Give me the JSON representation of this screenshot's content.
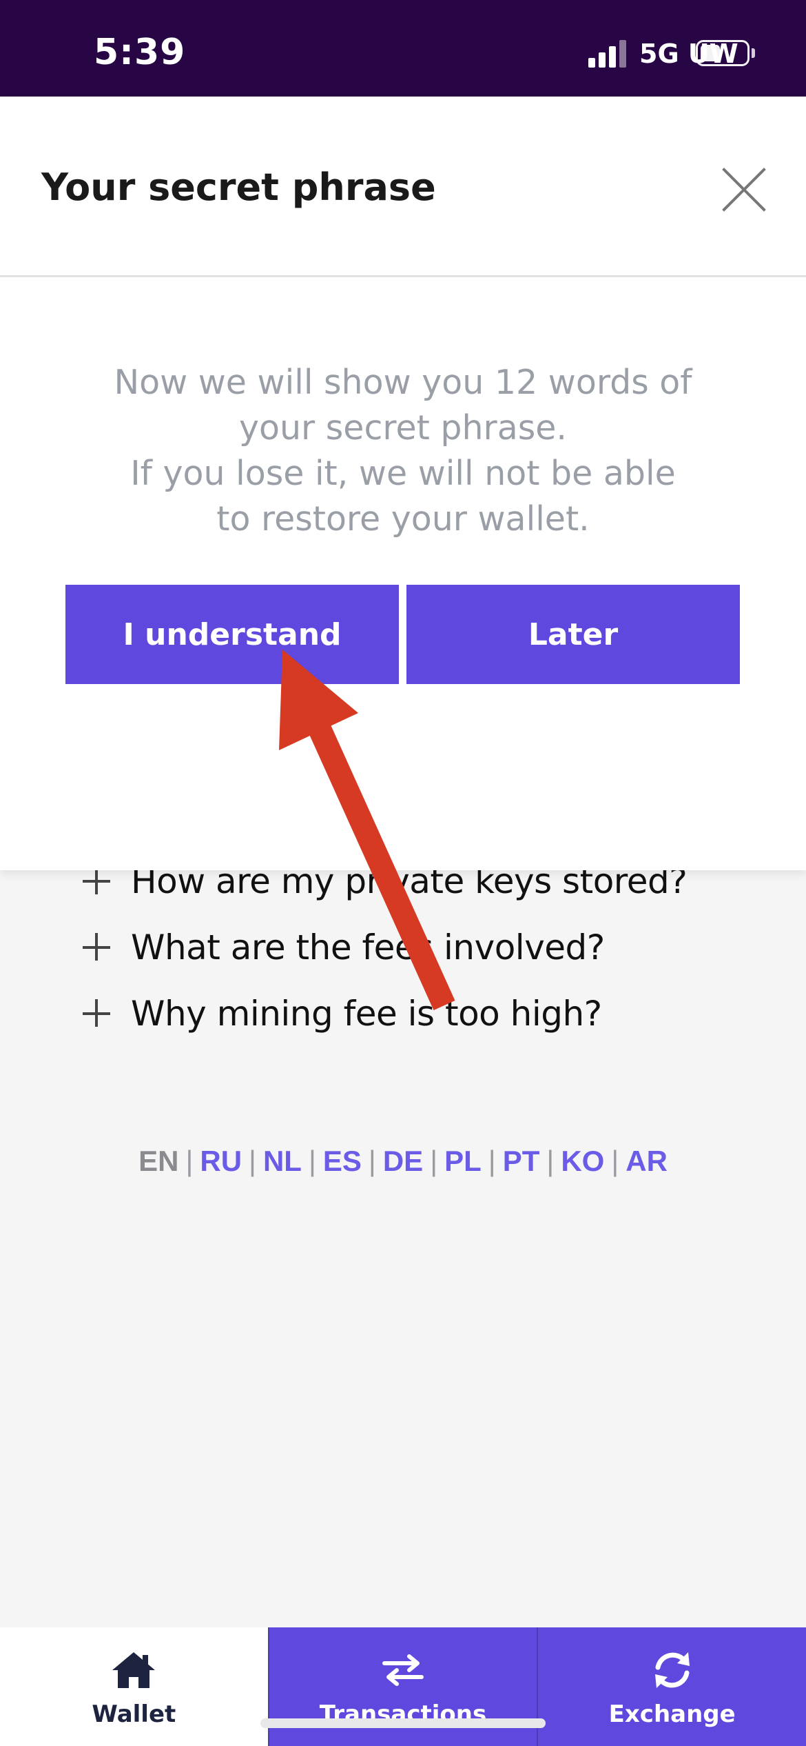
{
  "status_bar": {
    "time": "5:39",
    "network": "5G UW"
  },
  "background": {
    "faq": [
      "How are my private keys stored?",
      "What are the fees involved?",
      "Why mining fee is too high?"
    ],
    "languages": [
      {
        "code": "EN",
        "active": true
      },
      {
        "code": "RU",
        "active": false
      },
      {
        "code": "NL",
        "active": false
      },
      {
        "code": "ES",
        "active": false
      },
      {
        "code": "DE",
        "active": false
      },
      {
        "code": "PL",
        "active": false
      },
      {
        "code": "PT",
        "active": false
      },
      {
        "code": "KO",
        "active": false
      },
      {
        "code": "AR",
        "active": false
      }
    ]
  },
  "modal": {
    "title": "Your secret phrase",
    "message_lines": [
      "Now we will show you 12 words of",
      "your secret phrase.",
      "If you lose it, we will not be able",
      "to restore your wallet."
    ],
    "understand_label": "I understand",
    "later_label": "Later"
  },
  "bottom_nav": [
    {
      "label": "Wallet",
      "icon": "home-icon",
      "active": true
    },
    {
      "label": "Transactions",
      "icon": "transfer-arrows-icon",
      "active": false
    },
    {
      "label": "Exchange",
      "icon": "refresh-icon",
      "active": false
    }
  ],
  "colors": {
    "status_bar_bg": "#280646",
    "accent": "#5e48dd",
    "annotation_arrow": "#d63a23"
  }
}
